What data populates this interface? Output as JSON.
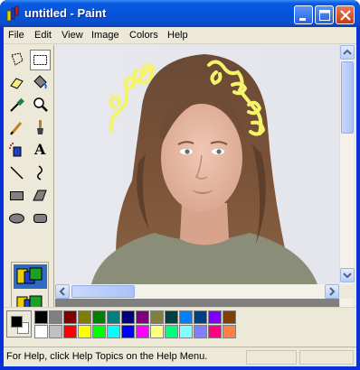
{
  "window": {
    "title": "untitled - Paint",
    "accent": "#0a5ce3"
  },
  "title_buttons": [
    {
      "name": "minimize",
      "icon": "minimize-icon"
    },
    {
      "name": "maximize",
      "icon": "maximize-icon"
    },
    {
      "name": "close",
      "icon": "close-icon"
    }
  ],
  "menu": {
    "items": [
      "File",
      "Edit",
      "View",
      "Image",
      "Colors",
      "Help"
    ]
  },
  "tools": [
    {
      "name": "free-form-select",
      "icon": "free-form-select-icon"
    },
    {
      "name": "select",
      "icon": "rectangle-select-icon",
      "selected": true
    },
    {
      "name": "eraser",
      "icon": "eraser-icon"
    },
    {
      "name": "fill",
      "icon": "fill-bucket-icon"
    },
    {
      "name": "pick-color",
      "icon": "eyedropper-icon"
    },
    {
      "name": "magnifier",
      "icon": "magnifier-icon"
    },
    {
      "name": "pencil",
      "icon": "pencil-icon"
    },
    {
      "name": "brush",
      "icon": "brush-icon"
    },
    {
      "name": "airbrush",
      "icon": "airbrush-icon"
    },
    {
      "name": "text",
      "icon": "text-icon",
      "glyph": "A"
    },
    {
      "name": "line",
      "icon": "line-icon"
    },
    {
      "name": "curve",
      "icon": "curve-icon"
    },
    {
      "name": "rectangle",
      "icon": "rectangle-icon"
    },
    {
      "name": "polygon",
      "icon": "polygon-icon"
    },
    {
      "name": "ellipse",
      "icon": "ellipse-icon"
    },
    {
      "name": "rounded-rectangle",
      "icon": "rounded-rectangle-icon"
    }
  ],
  "tool_options": {
    "items": [
      "opaque-selection-icon",
      "transparent-selection-icon"
    ]
  },
  "palette": {
    "foreground": "#000000",
    "background": "#ffffff",
    "row1": [
      "#000000",
      "#808080",
      "#800000",
      "#808000",
      "#008000",
      "#008080",
      "#000080",
      "#800080",
      "#808040",
      "#004040",
      "#0080ff",
      "#004080",
      "#8000ff",
      "#804000"
    ],
    "row2": [
      "#ffffff",
      "#c0c0c0",
      "#ff0000",
      "#ffff00",
      "#00ff00",
      "#00ffff",
      "#0000ff",
      "#ff00ff",
      "#ffff80",
      "#00ff80",
      "#80ffff",
      "#8080ff",
      "#ff0080",
      "#ff8040"
    ]
  },
  "status": {
    "text": "For Help, click Help Topics on the Help Menu."
  }
}
